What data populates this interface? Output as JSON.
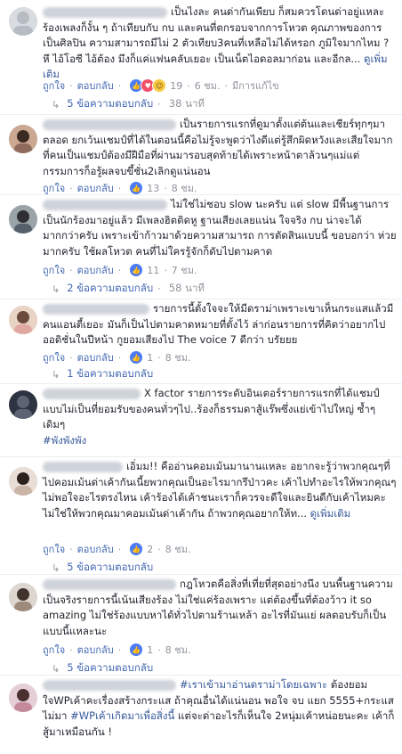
{
  "labels": {
    "like": "ถูกใจ",
    "reply": "ตอบกลับ",
    "edited": "มีการแก้ไข"
  },
  "comments": [
    {
      "text": "เป็นไงละ คนด่ากันเพียบ ก็สมควรโดนด่าอยู่แหละ ร้องเพลงก็งั้น ๆ ถ้าเทียบกับ กบ และคนที่ตกรอบจากการโหวต คุณภาพของการเป็นศิลปิน ความสามารถมีไม่ 2 ตัวเทียบ3คนที่เหลือไม่ได้หรอก ภูมิใจมากไหม ? หึ ไอ้โอซี ไอ้ต้อง มึงก็แค่แฟนคลับเยอะ เป็นเน็ตไอดอลมาก่อน และอีกล...",
      "more": "ดูเพิ่มเติม",
      "reactions": "19",
      "time": "6 ชม.",
      "edited": true,
      "replies": "5 ข้อความตอบกลับ",
      "replies_time": "38 นาที"
    },
    {
      "text": "เป็นรายการแรกที่ดูมาตั้งแต่ต้นและเชียร์ทุกๆมาตลอด ยกเว้นแชมป์ที่ได้ในตอนนี้คือไม่รู้จะพูดว่าไงดีแต่รู้สึกผิดหวังและเสียใจมาก ที่คนเป็นแชมป์ต้องมีฝีมือที่ผ่านมารอบสุดท้ายได้เพราะหน้าตาล้วนๆแม่แต่กรรมการก็อรู้ผลจบขึ้ชั่น2เลิกดูแน่นอน",
      "reactions": "13",
      "time": "8 ชม."
    },
    {
      "text": "ไม่ใช่ไม่ชอบ slow นะครับ แต่ slow มีพื้นฐานการเป็นนักร้องมาอยู่แล้ว มีเพลงฮิตติดหู ฐานเสียงเลยแน่น ใจจริง กบ น่าจะได้มากกว่าครับ เพราะเข้าก้าวมาด้วยความสามารถ การตัดสินแบบนี้ ขอบอกว่า ห่วยมากครับ ใช้ผลโหวต คนที่ไม่ใครรู้จักก็ดับไปตามคาด",
      "reactions": "11",
      "time": "7 ชม.",
      "replies": "2 ข้อความตอบกลับ",
      "replies_time": "58 นาที"
    },
    {
      "text": "รายการนี้ตั้งใจจะให้มีดราม่าเพราะเขาเห็นกระแสแล้วมีคนแอนตี้เยอะ มันก็เป็นไปตามคาดหมายที่ตั้งไว้ ล่าก่อนรายการที่คิดว่าอยากไปออดิชั่นในปีหน้า กูยอมเสียงไป The voice 7 ดีกว่า บรัยยย",
      "reactions": "1",
      "time": "8 ชม.",
      "replies": "1 ข้อความตอบกลับ"
    },
    {
      "text": "X factor รายการระดับอินเตอร์รายการแรกที่ได้แชมป์แบบไม่เป็นที่ยอมรับของคนทั่วๆไป..ร้องก็ธรรมดาสู้แร๊พซึ่งแย่เข้าไปใหญ่ ซ้ำๆเดิมๆ",
      "tag": "#พังพังพัง"
    },
    {
      "text": "เอิ่มม!! คืออ่านคอมเม้นมานานแหละ อยากจะรู้ว่าพวกคุณๆที่ไปคอมเม้นด่าเค้ากันเนี้ยพวกคุณเป็นอะไรมากรึป่าวคะ เค้าไปทำอะไรให้พวกคุณๆ ไม่พอใจอะไรตรงไหน เค้าร้องได้เค้าชนะเราก็ควรจะดีใจและยินดีกับเค้าไหมคะ ไม่ใช่ให้พวกคุณมาคอมเม้นด่าเค้ากัน ถ้าพวกคุณอยากให้ท...",
      "more": "ดูเพิ่มเติม",
      "reactions": "2",
      "time": "8 ชม.",
      "replies": "5 ข้อความตอบกลับ"
    },
    {
      "text": "กฎโหวตคือสิ่งที่เที่ยที่สุดอย่างนึง บนพื้นฐานความเป็นจริงรายการนี้เน้นเสียงร้อง ไม่ใช่แค่ร้องเพราะ แต่ต้องขึ้นที่ต้องว้าว it so amazing ไม่ใช่ร้องแบบหาได้ทั่วไปตามร้านเหล้า อะไรที่มันแย่ ผลตอบรับก็เป็นแบบนี้แหละนะ",
      "reactions": "1",
      "time": "8 ชม.",
      "replies": "5 ข้อความตอบกลับ"
    },
    {
      "text_pre": "",
      "tag_inline": "#เราเข้ามาอ่านดราม่าโดยเฉพาะ",
      "text": " ต้องยอมใจWPเค้าคะเรื่องสร้างกระแส ถ้าคุณอื่นได้แน่นอน พอใจ จบ แยก 5555+กระแสไม่มา",
      "tag2": "#WPเค้าเกิดมาเพื่อสิ่งนี้",
      "text2": " แต่จะด่าอะไรก็เห็นใจ 2หนุ่มเค้าหน่อยนะคะ เค้าก็สู้มาเหมือนกัน !"
    }
  ]
}
